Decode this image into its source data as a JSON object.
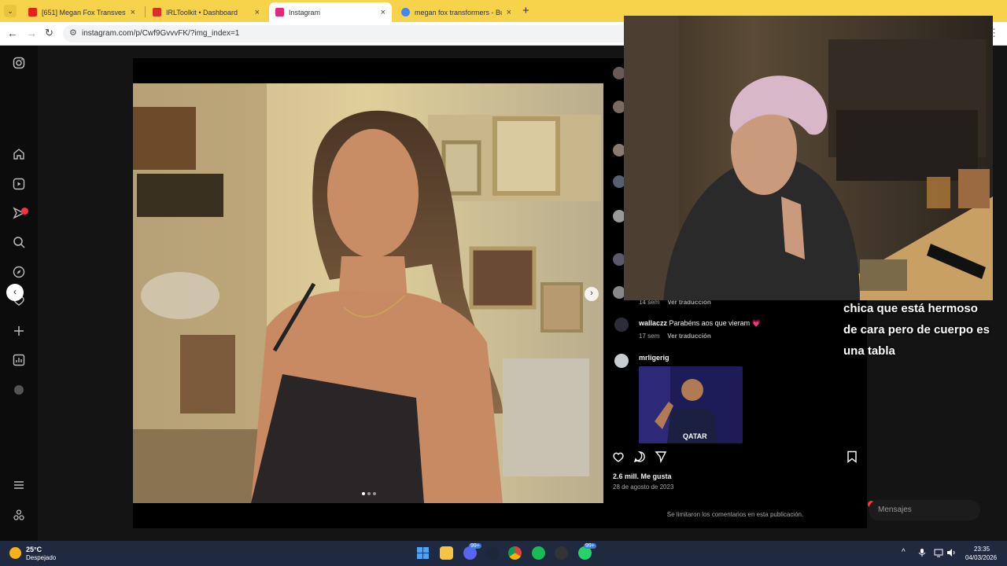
{
  "browser": {
    "tabs": [
      {
        "title": "[651] Megan Fox Transvestigati",
        "favicon_color": "#e62117"
      },
      {
        "title": "IRLToolkit • Dashboard",
        "favicon_color": "#d93025"
      },
      {
        "title": "Instagram",
        "favicon_color": "#dd2a7b"
      },
      {
        "title": "megan fox transformers - Busc",
        "favicon_color": "#4285f4"
      }
    ],
    "active_tab": 2,
    "tab_close": "×",
    "new_tab": "+",
    "url": "instagram.com/p/Cwf9GvvvFK/?img_index=1",
    "accent": "#f6d34a"
  },
  "instagram": {
    "rail_icons": [
      "instagram-logo-icon",
      "home-icon",
      "reels-icon",
      "activity-icon",
      "search-icon",
      "explore-icon",
      "notifications-icon",
      "create-icon",
      "dashboard-icon",
      "profile-icon",
      "menu-icon",
      "more-icon"
    ]
  },
  "post": {
    "comments": [
      {
        "user": "",
        "meta_time": "14 sem",
        "meta_action": "Ver traducción"
      },
      {
        "user": "wallaczz",
        "text": "Parabéns aos que vieram 💗",
        "meta_time": "17 sem",
        "meta_action": "Ver traducción"
      },
      {
        "user": "mrligerig",
        "text": "",
        "gif_text": "QATAR"
      }
    ],
    "likes": "2.6 mill. Me gusta",
    "date": "28 de agosto de 2023",
    "comments_limited": "Se limitaron los comentarios en esta publicación."
  },
  "overlay": {
    "caption": "chica que está hermoso de cara pero de cuerpo es una tabla",
    "messages_label": "Mensajes"
  },
  "taskbar": {
    "temperature": "25°C",
    "weather": "Despejado",
    "time": "23:35",
    "date": "04/03/2026",
    "discord_badge": "99+",
    "whatsapp_badge": "99+"
  }
}
